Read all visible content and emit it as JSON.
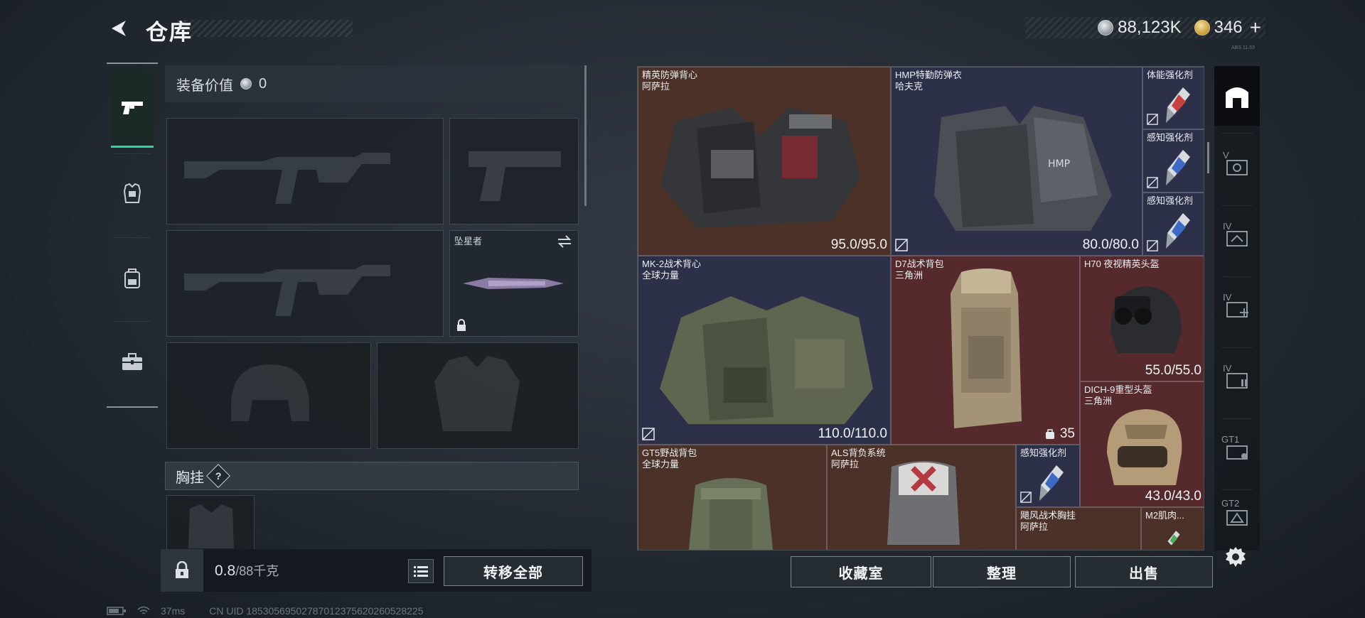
{
  "header": {
    "title": "仓库",
    "currency": [
      {
        "icon": "silver-coin-icon",
        "value": "88,123K"
      },
      {
        "icon": "gold-coin-icon",
        "value": "346"
      }
    ],
    "plus_label": "+",
    "corner_tag": "ABS 11.63"
  },
  "left_nav": {
    "items": [
      {
        "icon": "pistol-icon",
        "active": true
      },
      {
        "icon": "armor-icon",
        "active": false
      },
      {
        "icon": "backpack-icon",
        "active": false
      },
      {
        "icon": "toolbox-icon",
        "active": false
      }
    ]
  },
  "equipment": {
    "value_label": "装备价值",
    "value": "0",
    "melee_name": "坠星者",
    "chest_rig_label": "胸挂",
    "help_label": "?"
  },
  "weight": {
    "current": "0.8",
    "capacity": "/88千克"
  },
  "buttons": {
    "transfer_all": "转移全部",
    "collection_room": "收藏室",
    "sort": "整理",
    "sell": "出售"
  },
  "status": {
    "latency": "37ms",
    "uid": "CN UID 18530569502787012375620260528225"
  },
  "storage": {
    "items": [
      {
        "name": "精英防弹背心",
        "origin": "阿萨拉",
        "durability": "95.0/95.0",
        "bg": "brown"
      },
      {
        "name": "HMP特勤防弹衣",
        "origin": "哈夫克",
        "durability": "80.0/80.0",
        "bg": "navy"
      },
      {
        "name": "体能强化剂",
        "origin": "",
        "durability": "",
        "bg": "navy"
      },
      {
        "name": "感知强化剂",
        "origin": "",
        "durability": "",
        "bg": "navy"
      },
      {
        "name": "感知强化剂",
        "origin": "",
        "durability": "",
        "bg": "navy"
      },
      {
        "name": "MK-2战术背心",
        "origin": "全球力量",
        "durability": "110.0/110.0",
        "bg": "navy"
      },
      {
        "name": "D7战术背包",
        "origin": "三角洲",
        "count": "35",
        "bg": "red"
      },
      {
        "name": "H70 夜视精英头盔",
        "origin": "",
        "durability": "55.0/55.0",
        "bg": "red"
      },
      {
        "name": "DICH-9重型头盔",
        "origin": "三角洲",
        "durability": "43.0/43.0",
        "bg": "red"
      },
      {
        "name": "GT5野战背包",
        "origin": "全球力量",
        "bg": "brown"
      },
      {
        "name": "ALS背负系统",
        "origin": "阿萨拉",
        "bg": "brown"
      },
      {
        "name": "感知强化剂",
        "origin": "",
        "bg": "navy"
      },
      {
        "name": "飓风战术胸挂",
        "origin": "阿萨拉",
        "bg": "brown"
      },
      {
        "name": "M2肌肉...",
        "origin": "",
        "bg": "brown"
      }
    ]
  },
  "right_nav": {
    "tags": [
      "V",
      "IV",
      "IV",
      "IV",
      "GT1",
      "GT2"
    ]
  }
}
